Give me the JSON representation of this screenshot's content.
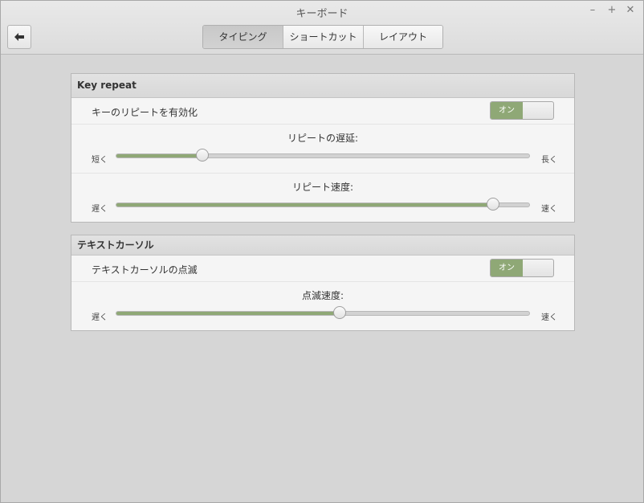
{
  "window": {
    "title": "キーボード",
    "minimize": "–",
    "maximize": "+",
    "close": "✕"
  },
  "back_icon": "left-arrow-icon",
  "tabs": [
    {
      "label": "タイピング",
      "active": true
    },
    {
      "label": "ショートカット",
      "active": false
    },
    {
      "label": "レイアウト",
      "active": false
    }
  ],
  "key_repeat": {
    "header": "Key repeat",
    "enable_label": "キーのリピートを有効化",
    "enable_state": "オン",
    "delay": {
      "title": "リピートの遅延:",
      "min_label": "短く",
      "max_label": "長く",
      "value": 0.21
    },
    "speed": {
      "title": "リピート速度:",
      "min_label": "遅く",
      "max_label": "速く",
      "value": 0.91
    }
  },
  "cursor": {
    "header": "テキストカーソル",
    "blink_label": "テキストカーソルの点滅",
    "blink_state": "オン",
    "blink_speed": {
      "title": "点滅速度:",
      "min_label": "遅く",
      "max_label": "速く",
      "value": 0.54
    }
  },
  "colors": {
    "accent": "#8fa876"
  }
}
